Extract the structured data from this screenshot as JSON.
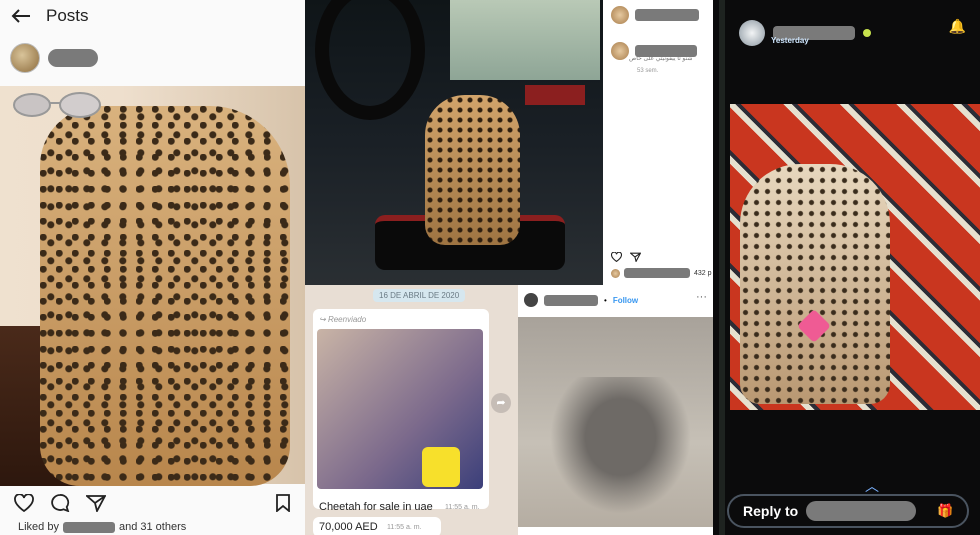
{
  "instagram_post": {
    "header_title": "Posts",
    "likes_prefix": "Liked by",
    "likes_suffix": "and 31 others",
    "icons": [
      "back-arrow-icon",
      "heart-icon",
      "comment-icon",
      "send-icon",
      "bookmark-icon"
    ]
  },
  "instagram_side": {
    "arabic_caption": "شنو تا ييقونيتي على خاص",
    "time": "53 sem."
  },
  "instagram_sidebar_bottom": {
    "count": "432 p"
  },
  "whatsapp": {
    "date_chip": "16 DE ABRIL DE 2020",
    "forwarded_label": "Reenviado",
    "message_1": "Cheetah for sale in uae",
    "time_1": "11:55 a. m.",
    "message_2": "70,000 AED",
    "time_2": "11:55 a. m.",
    "snap_time": "11:55 a. m."
  },
  "instagram_cubs": {
    "follow_label": "Follow",
    "more_label": "···"
  },
  "snapchat": {
    "timestamp": "Yesterday",
    "reply_label": "Reply to",
    "accent": "#c7e24d"
  }
}
